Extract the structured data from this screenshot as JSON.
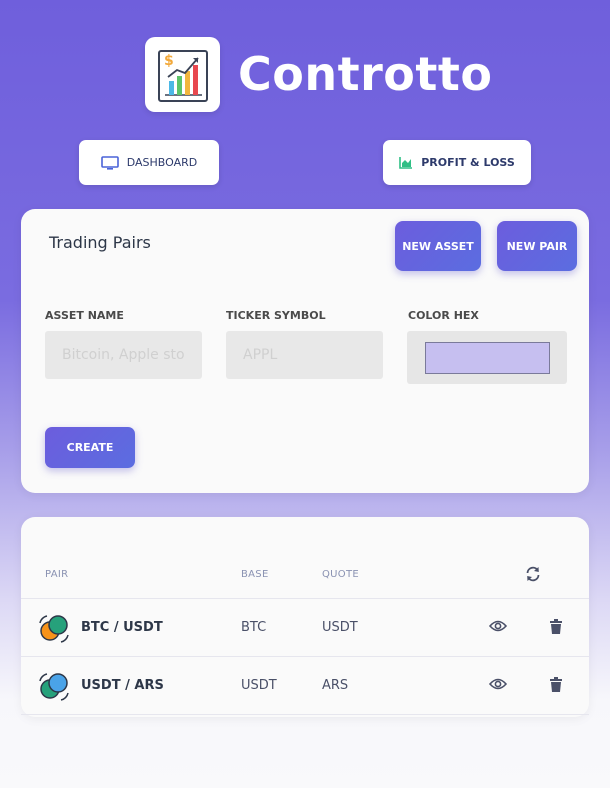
{
  "app": {
    "title": "Controtto",
    "logo_icon": "chart-growth-icon"
  },
  "nav": {
    "dashboard_label": "DASHBOARD",
    "dashboard_icon": "monitor-icon",
    "profit_loss_label": "PROFIT & LOSS",
    "profit_loss_icon": "area-chart-icon"
  },
  "form": {
    "title": "Trading Pairs",
    "new_asset_label": "NEW ASSET",
    "new_pair_label": "NEW PAIR",
    "asset_name": {
      "label": "ASSET NAME",
      "placeholder": "Bitcoin, Apple stock",
      "value": ""
    },
    "ticker_symbol": {
      "label": "TICKER SYMBOL",
      "placeholder": "APPL",
      "value": ""
    },
    "color_hex": {
      "label": "COLOR HEX",
      "value": "#c6bff0"
    },
    "create_label": "CREATE"
  },
  "table": {
    "columns": [
      "PAIR",
      "BASE",
      "QUOTE"
    ],
    "refresh_icon": "refresh-icon",
    "rows": [
      {
        "pair": "BTC / USDT",
        "base": "BTC",
        "quote": "USDT",
        "base_color": "#f7931a",
        "quote_color": "#26a17b"
      },
      {
        "pair": "USDT / ARS",
        "base": "USDT",
        "quote": "ARS",
        "base_color": "#26a17b",
        "quote_color": "#4aa3e8"
      }
    ]
  },
  "colors": {
    "accent": "#6c5ddd",
    "background_top": "#6f5fdc",
    "card": "#fafafa"
  }
}
